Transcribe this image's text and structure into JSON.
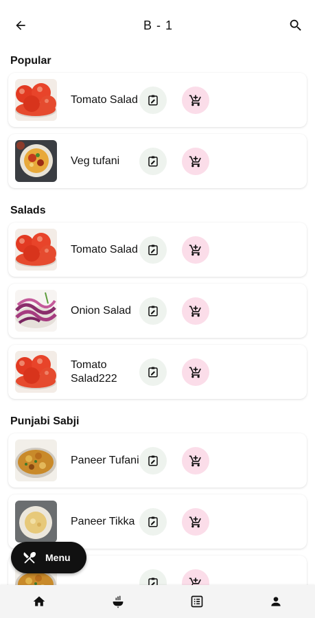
{
  "header": {
    "title": "B - 1",
    "back_icon": "arrow-left-icon",
    "search_icon": "search-icon"
  },
  "sections": [
    {
      "title": "Popular",
      "items": [
        {
          "name": "Tomato Salad",
          "image": "tomato"
        },
        {
          "name": "Veg tufani",
          "image": "bowl"
        }
      ]
    },
    {
      "title": "Salads",
      "items": [
        {
          "name": "Tomato Salad",
          "image": "tomato"
        },
        {
          "name": "Onion Salad",
          "image": "onion"
        },
        {
          "name": "Tomato Salad222",
          "image": "tomato"
        }
      ]
    },
    {
      "title": "Punjabi Sabji",
      "items": [
        {
          "name": "Paneer Tufani",
          "image": "curry"
        },
        {
          "name": "Paneer Tikka",
          "image": "plate"
        },
        {
          "name": "",
          "image": "curry"
        }
      ]
    }
  ],
  "fab": {
    "label": "Menu",
    "icon": "utensils-icon"
  },
  "bottom_nav": [
    {
      "icon": "home-icon"
    },
    {
      "icon": "cooking-pot-icon"
    },
    {
      "icon": "list-icon"
    },
    {
      "icon": "person-icon"
    }
  ],
  "colors": {
    "edit_bg": "#eef3ee",
    "cart_bg": "#fbdde9",
    "fab_bg": "#111111",
    "nav_bg": "#f4f4f4"
  }
}
